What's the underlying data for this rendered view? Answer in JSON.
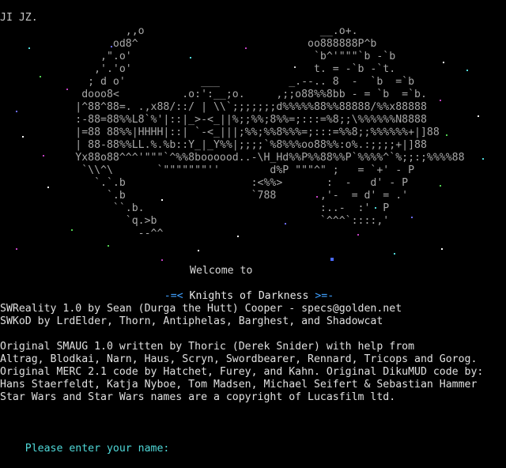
{
  "header": {
    "text": "JI JZ."
  },
  "art": [
    "                    ,,o                            __.o+.",
    "                  od8^                           oo888888P^b",
    "                ,\".o'                             `b^'\"\"\"`b -`b",
    "               ,'.'o'                             t. = -`b -`t.",
    "              ; d o'            ___           _.--.. 8  -  `b  =`b",
    "             dooo8<          .o:':__;o.     ,;;o88%%8bb - = `b  =`b.",
    "            |^88^88=. .,x88/::/ | \\\\`;;;;;;;d%%%%%88%%88888/%%x88888",
    "            :-88=88%%L8`%'|::|_>-<_||%;;%%;8%%=;:::=%8;;\\%%%%%%N8888",
    "            |=88 88%%|HHHH|::| `-<_|||;%%;%%8%%%=;:::=%%8;;%%%%%%+|]88",
    "            | 88-88%%LL.%.%b::Y_|_Y%%|;;;;`%8%%%oo88%%:o%.:;;;;+|]88",
    "            Yx88o88^^^'\"\"\"`^%%8boooood..-\\H_Hd%%P%%88%%P`%%%%^`%;;:;%%%%88",
    "             `\\\\^\\       `\"\"\"\"\"\"\"''        d%P \"\"\"^\" ;   = `+' - P",
    "               `.`.b                    :<%%>       :  -   d' - P",
    "                 `.b                    `788       ,'-  = d' = .'",
    "                  ``.b.                            :..-  :'  P",
    "                    `q.>b                          `^^^`::::,'",
    "                      --^^"
  ],
  "welcome": {
    "line1": "Welcome to",
    "left_bracket": "-=<",
    "title": " Knights of Darkness ",
    "right_bracket": ">=-"
  },
  "credits": [
    "SWReality 1.0 by Sean (Durga the Hutt) Cooper - specs@golden.net",
    "SWKoD by LrdElder, Thorn, Antiphelas, Barghest, and Shadowcat",
    "",
    "Original SMAUG 1.0 written by Thoric (Derek Snider) with help from",
    "Altrag, Blodkai, Narn, Haus, Scryn, Swordbearer, Rennard, Tricops and Gorog.",
    "Original MERC 2.1 code by Hatchet, Furey, and Kahn. Original DikuMUD code by:",
    "Hans Staerfeldt, Katja Nyboe, Tom Madsen, Michael Seifert & Sebastian Hammer",
    "Star Wars and Star Wars names are a copyright of Lucasfilm ltd."
  ],
  "prompt": {
    "label": "Please enter your name:"
  },
  "colors": {
    "background": "#000000",
    "prompt": "#4fd8d8",
    "bracket": "#3fa0ff",
    "text": "#e0e0e0"
  }
}
